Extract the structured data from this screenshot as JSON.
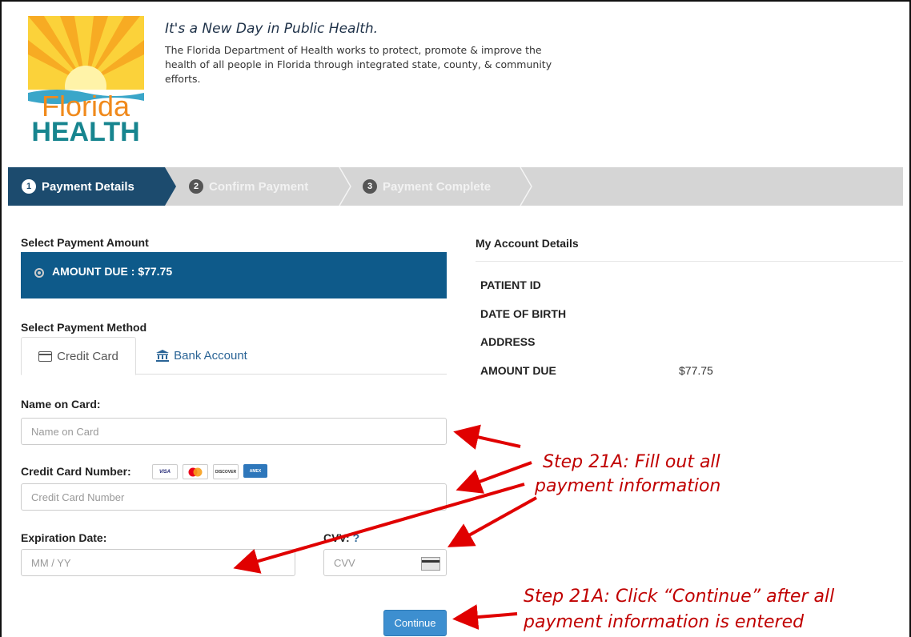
{
  "header": {
    "logo_top": "Florida",
    "logo_bottom": "HEALTH",
    "tagline": "It's a New Day in Public Health.",
    "intro": "The Florida Department of Health works to protect, promote & improve the health of all people in Florida through integrated state, county, & community efforts."
  },
  "steps": [
    {
      "num": "1",
      "label": "Payment Details",
      "active": true
    },
    {
      "num": "2",
      "label": "Confirm Payment",
      "active": false
    },
    {
      "num": "3",
      "label": "Payment Complete",
      "active": false
    }
  ],
  "form": {
    "amount_heading": "Select Payment Amount",
    "amount_option": "AMOUNT DUE : $77.75",
    "method_heading": "Select Payment Method",
    "tab_credit_card": "Credit Card",
    "tab_bank_account": "Bank Account",
    "name_label": "Name on Card:",
    "name_placeholder": "Name on Card",
    "cc_label": "Credit Card Number:",
    "cc_placeholder": "Credit Card Number",
    "card_brands": [
      "VISA",
      "MC",
      "DISCOVER",
      "AMEX"
    ],
    "exp_label": "Expiration Date:",
    "exp_placeholder": "MM / YY",
    "cvv_label": "CVV:",
    "cvv_help": "?",
    "cvv_placeholder": "CVV",
    "continue_label": "Continue"
  },
  "account": {
    "title": "My Account Details",
    "rows": [
      {
        "label": "PATIENT ID",
        "value": ""
      },
      {
        "label": "DATE OF BIRTH",
        "value": ""
      },
      {
        "label": "ADDRESS",
        "value": ""
      },
      {
        "label": "AMOUNT DUE",
        "value": "$77.75"
      }
    ]
  },
  "annotations": {
    "step_fill_1": "Step 21A: Fill out all",
    "step_fill_2": "payment information",
    "step_continue_1": "Step 21A: Click “Continue” after all",
    "step_continue_2": "payment information is entered"
  },
  "colors": {
    "step_active": "#1c4b6e",
    "amount_box": "#0e5a8a",
    "annotation": "#c00000",
    "button": "#3d8fd0"
  }
}
